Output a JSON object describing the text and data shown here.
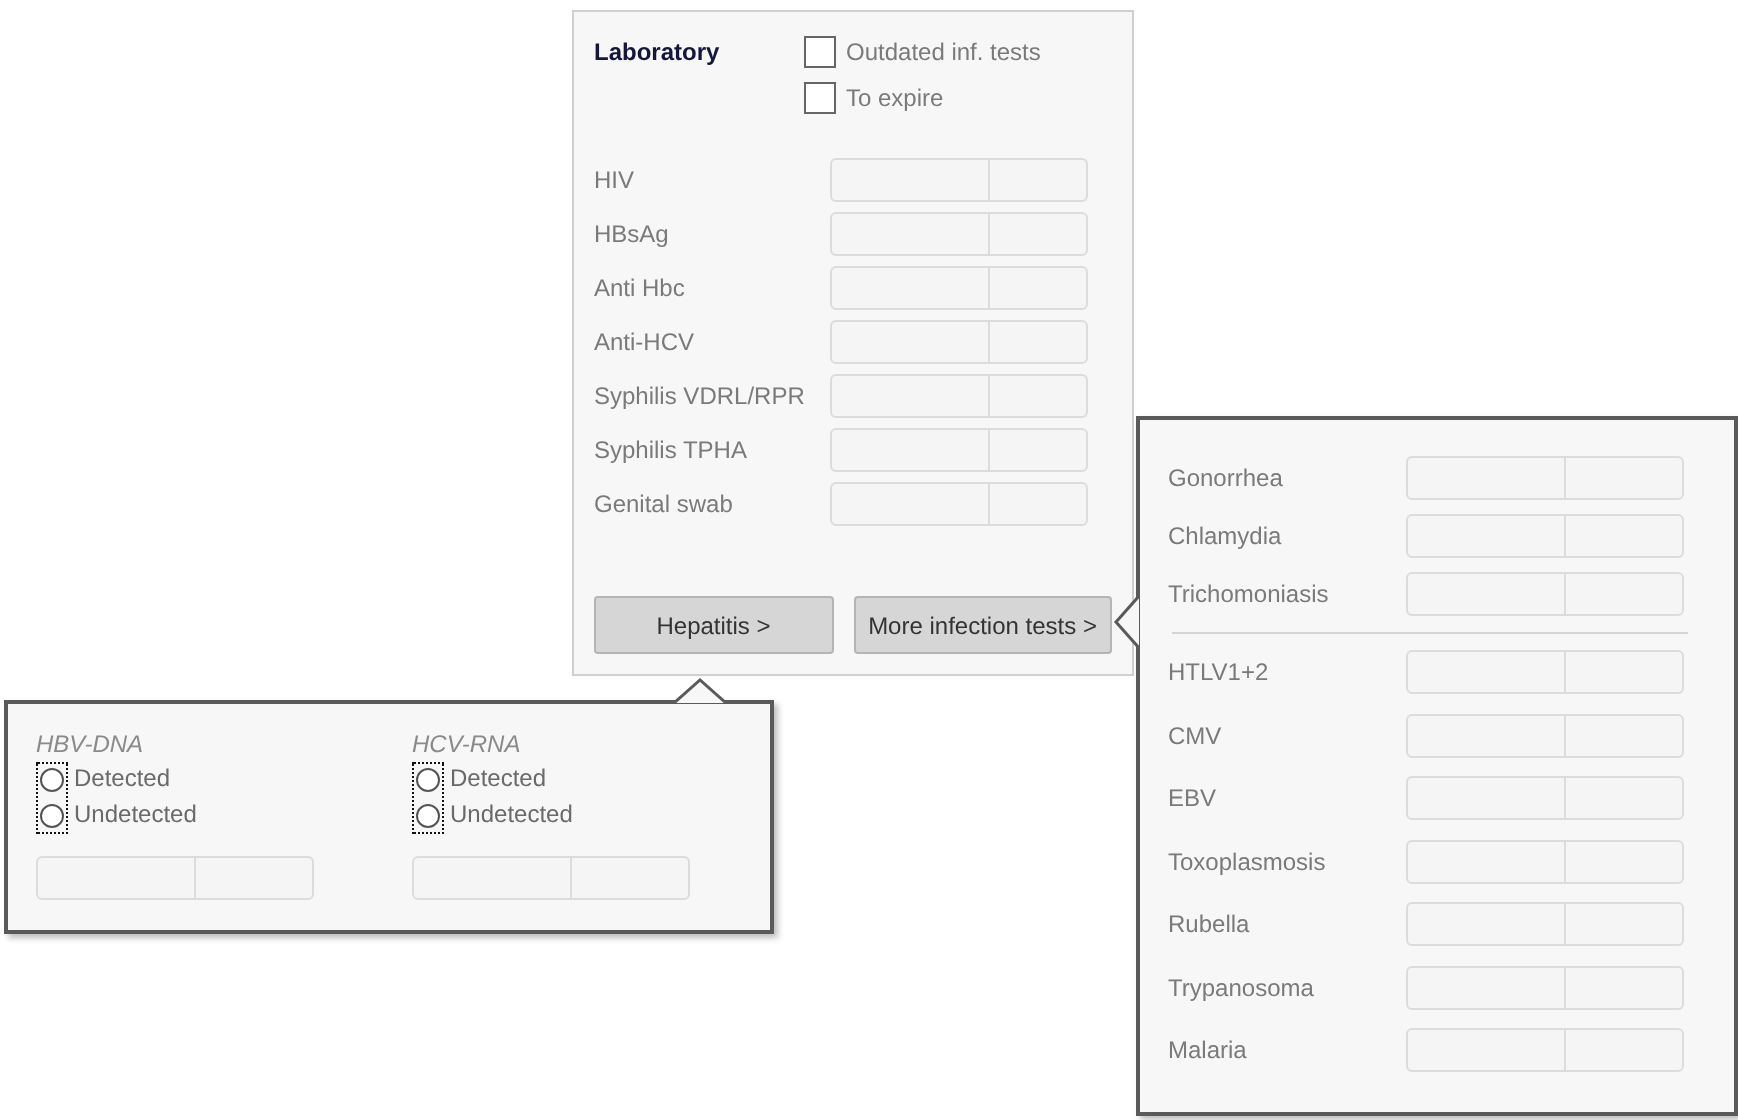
{
  "laboratory": {
    "title": "Laboratory",
    "filters": [
      {
        "label": "Outdated inf. tests",
        "checked": false
      },
      {
        "label": "To expire",
        "checked": false
      }
    ],
    "tests": [
      {
        "label": "HIV"
      },
      {
        "label": "HBsAg"
      },
      {
        "label": "Anti Hbc"
      },
      {
        "label": "Anti-HCV"
      },
      {
        "label": "Syphilis VDRL/RPR"
      },
      {
        "label": "Syphilis TPHA"
      },
      {
        "label": "Genital swab"
      }
    ],
    "buttons": [
      {
        "label": "Hepatitis >"
      },
      {
        "label": "More infection tests >"
      }
    ]
  },
  "hepatitis": {
    "groups": [
      {
        "title": "HBV-DNA",
        "focused": true,
        "options": [
          {
            "label": "Detected",
            "selected": false
          },
          {
            "label": "Undetected",
            "selected": false
          }
        ]
      },
      {
        "title": "HCV-RNA",
        "focused": true,
        "options": [
          {
            "label": "Detected",
            "selected": false
          },
          {
            "label": "Undetected",
            "selected": false
          }
        ]
      }
    ]
  },
  "more_infection_tests": {
    "sections": [
      {
        "tests": [
          {
            "label": "Gonorrhea"
          },
          {
            "label": "Chlamydia"
          },
          {
            "label": "Trichomoniasis"
          }
        ]
      },
      {
        "tests": [
          {
            "label": "HTLV1+2"
          },
          {
            "label": "CMV"
          },
          {
            "label": "EBV"
          },
          {
            "label": "Toxoplasmosis"
          },
          {
            "label": "Rubella"
          },
          {
            "label": "Trypanosoma"
          },
          {
            "label": "Malaria"
          }
        ]
      }
    ]
  }
}
